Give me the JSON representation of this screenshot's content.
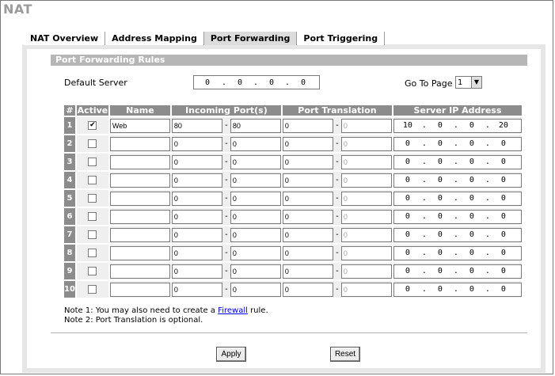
{
  "page": {
    "title": "NAT"
  },
  "tabs": [
    {
      "label": "NAT Overview"
    },
    {
      "label": "Address Mapping"
    },
    {
      "label": "Port Forwarding",
      "active": true
    },
    {
      "label": "Port Triggering"
    }
  ],
  "section": {
    "title": "Port Forwarding Rules"
  },
  "default_server": {
    "label": "Default Server",
    "ip": [
      "0",
      "0",
      "0",
      "0"
    ]
  },
  "goto_page": {
    "label": "Go To Page",
    "value": "1"
  },
  "table": {
    "headers": {
      "num": "#",
      "active": "Active",
      "name": "Name",
      "incoming": "Incoming Port(s)",
      "translation": "Port Translation",
      "server_ip": "Server IP Address"
    },
    "rows": [
      {
        "num": "1",
        "active": true,
        "name": "Web",
        "in_start": "80",
        "in_end": "80",
        "tr_start": "0",
        "tr_end": "0",
        "ip": [
          "10",
          "0",
          "0",
          "20"
        ]
      },
      {
        "num": "2",
        "active": false,
        "name": "",
        "in_start": "0",
        "in_end": "0",
        "tr_start": "0",
        "tr_end": "0",
        "ip": [
          "0",
          "0",
          "0",
          "0"
        ]
      },
      {
        "num": "3",
        "active": false,
        "name": "",
        "in_start": "0",
        "in_end": "0",
        "tr_start": "0",
        "tr_end": "0",
        "ip": [
          "0",
          "0",
          "0",
          "0"
        ]
      },
      {
        "num": "4",
        "active": false,
        "name": "",
        "in_start": "0",
        "in_end": "0",
        "tr_start": "0",
        "tr_end": "0",
        "ip": [
          "0",
          "0",
          "0",
          "0"
        ]
      },
      {
        "num": "5",
        "active": false,
        "name": "",
        "in_start": "0",
        "in_end": "0",
        "tr_start": "0",
        "tr_end": "0",
        "ip": [
          "0",
          "0",
          "0",
          "0"
        ]
      },
      {
        "num": "6",
        "active": false,
        "name": "",
        "in_start": "0",
        "in_end": "0",
        "tr_start": "0",
        "tr_end": "0",
        "ip": [
          "0",
          "0",
          "0",
          "0"
        ]
      },
      {
        "num": "7",
        "active": false,
        "name": "",
        "in_start": "0",
        "in_end": "0",
        "tr_start": "0",
        "tr_end": "0",
        "ip": [
          "0",
          "0",
          "0",
          "0"
        ]
      },
      {
        "num": "8",
        "active": false,
        "name": "",
        "in_start": "0",
        "in_end": "0",
        "tr_start": "0",
        "tr_end": "0",
        "ip": [
          "0",
          "0",
          "0",
          "0"
        ]
      },
      {
        "num": "9",
        "active": false,
        "name": "",
        "in_start": "0",
        "in_end": "0",
        "tr_start": "0",
        "tr_end": "0",
        "ip": [
          "0",
          "0",
          "0",
          "0"
        ]
      },
      {
        "num": "10",
        "active": false,
        "name": "",
        "in_start": "0",
        "in_end": "0",
        "tr_start": "0",
        "tr_end": "0",
        "ip": [
          "0",
          "0",
          "0",
          "0"
        ]
      }
    ]
  },
  "notes": {
    "note1_prefix": "Note 1: You may also need to create a ",
    "note1_link": "Firewall",
    "note1_suffix": " rule.",
    "note2": "Note 2: Port Translation is optional."
  },
  "buttons": {
    "apply": "Apply",
    "reset": "Reset"
  },
  "colors": {
    "header_bg": "#8c8c8c",
    "section_bar": "#b6b6b6",
    "link": "#0000ee"
  }
}
